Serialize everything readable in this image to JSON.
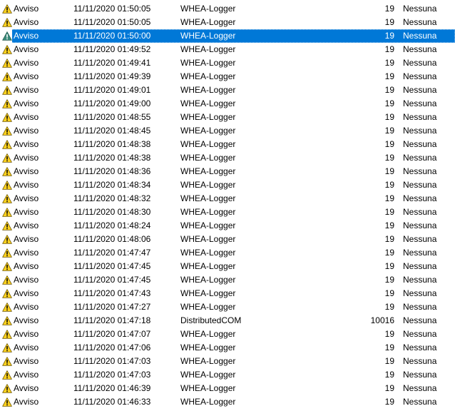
{
  "colors": {
    "selection_bg": "#0078d7",
    "warning_yellow": "#ffd21f",
    "warning_selected": "#3a8a7a"
  },
  "icon": "warning-icon",
  "selected_index": 2,
  "events": [
    {
      "level": "Avviso",
      "datetime": "11/11/2020 01:50:05",
      "source": "WHEA-Logger",
      "event_id": "19",
      "category": "Nessuna"
    },
    {
      "level": "Avviso",
      "datetime": "11/11/2020 01:50:05",
      "source": "WHEA-Logger",
      "event_id": "19",
      "category": "Nessuna"
    },
    {
      "level": "Avviso",
      "datetime": "11/11/2020 01:50:00",
      "source": "WHEA-Logger",
      "event_id": "19",
      "category": "Nessuna"
    },
    {
      "level": "Avviso",
      "datetime": "11/11/2020 01:49:52",
      "source": "WHEA-Logger",
      "event_id": "19",
      "category": "Nessuna"
    },
    {
      "level": "Avviso",
      "datetime": "11/11/2020 01:49:41",
      "source": "WHEA-Logger",
      "event_id": "19",
      "category": "Nessuna"
    },
    {
      "level": "Avviso",
      "datetime": "11/11/2020 01:49:39",
      "source": "WHEA-Logger",
      "event_id": "19",
      "category": "Nessuna"
    },
    {
      "level": "Avviso",
      "datetime": "11/11/2020 01:49:01",
      "source": "WHEA-Logger",
      "event_id": "19",
      "category": "Nessuna"
    },
    {
      "level": "Avviso",
      "datetime": "11/11/2020 01:49:00",
      "source": "WHEA-Logger",
      "event_id": "19",
      "category": "Nessuna"
    },
    {
      "level": "Avviso",
      "datetime": "11/11/2020 01:48:55",
      "source": "WHEA-Logger",
      "event_id": "19",
      "category": "Nessuna"
    },
    {
      "level": "Avviso",
      "datetime": "11/11/2020 01:48:45",
      "source": "WHEA-Logger",
      "event_id": "19",
      "category": "Nessuna"
    },
    {
      "level": "Avviso",
      "datetime": "11/11/2020 01:48:38",
      "source": "WHEA-Logger",
      "event_id": "19",
      "category": "Nessuna"
    },
    {
      "level": "Avviso",
      "datetime": "11/11/2020 01:48:38",
      "source": "WHEA-Logger",
      "event_id": "19",
      "category": "Nessuna"
    },
    {
      "level": "Avviso",
      "datetime": "11/11/2020 01:48:36",
      "source": "WHEA-Logger",
      "event_id": "19",
      "category": "Nessuna"
    },
    {
      "level": "Avviso",
      "datetime": "11/11/2020 01:48:34",
      "source": "WHEA-Logger",
      "event_id": "19",
      "category": "Nessuna"
    },
    {
      "level": "Avviso",
      "datetime": "11/11/2020 01:48:32",
      "source": "WHEA-Logger",
      "event_id": "19",
      "category": "Nessuna"
    },
    {
      "level": "Avviso",
      "datetime": "11/11/2020 01:48:30",
      "source": "WHEA-Logger",
      "event_id": "19",
      "category": "Nessuna"
    },
    {
      "level": "Avviso",
      "datetime": "11/11/2020 01:48:24",
      "source": "WHEA-Logger",
      "event_id": "19",
      "category": "Nessuna"
    },
    {
      "level": "Avviso",
      "datetime": "11/11/2020 01:48:06",
      "source": "WHEA-Logger",
      "event_id": "19",
      "category": "Nessuna"
    },
    {
      "level": "Avviso",
      "datetime": "11/11/2020 01:47:47",
      "source": "WHEA-Logger",
      "event_id": "19",
      "category": "Nessuna"
    },
    {
      "level": "Avviso",
      "datetime": "11/11/2020 01:47:45",
      "source": "WHEA-Logger",
      "event_id": "19",
      "category": "Nessuna"
    },
    {
      "level": "Avviso",
      "datetime": "11/11/2020 01:47:45",
      "source": "WHEA-Logger",
      "event_id": "19",
      "category": "Nessuna"
    },
    {
      "level": "Avviso",
      "datetime": "11/11/2020 01:47:43",
      "source": "WHEA-Logger",
      "event_id": "19",
      "category": "Nessuna"
    },
    {
      "level": "Avviso",
      "datetime": "11/11/2020 01:47:27",
      "source": "WHEA-Logger",
      "event_id": "19",
      "category": "Nessuna"
    },
    {
      "level": "Avviso",
      "datetime": "11/11/2020 01:47:18",
      "source": "DistributedCOM",
      "event_id": "10016",
      "category": "Nessuna"
    },
    {
      "level": "Avviso",
      "datetime": "11/11/2020 01:47:07",
      "source": "WHEA-Logger",
      "event_id": "19",
      "category": "Nessuna"
    },
    {
      "level": "Avviso",
      "datetime": "11/11/2020 01:47:06",
      "source": "WHEA-Logger",
      "event_id": "19",
      "category": "Nessuna"
    },
    {
      "level": "Avviso",
      "datetime": "11/11/2020 01:47:03",
      "source": "WHEA-Logger",
      "event_id": "19",
      "category": "Nessuna"
    },
    {
      "level": "Avviso",
      "datetime": "11/11/2020 01:47:03",
      "source": "WHEA-Logger",
      "event_id": "19",
      "category": "Nessuna"
    },
    {
      "level": "Avviso",
      "datetime": "11/11/2020 01:46:39",
      "source": "WHEA-Logger",
      "event_id": "19",
      "category": "Nessuna"
    },
    {
      "level": "Avviso",
      "datetime": "11/11/2020 01:46:33",
      "source": "WHEA-Logger",
      "event_id": "19",
      "category": "Nessuna"
    }
  ]
}
